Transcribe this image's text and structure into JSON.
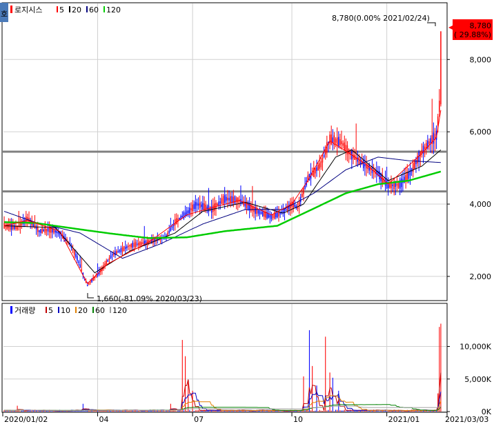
{
  "colors": {
    "up": "#ff0000",
    "down": "#0000ff",
    "ma5": "#ff0000",
    "ma20": "#000000",
    "ma60": "#000080",
    "ma120": "#00cc00",
    "vol5": "#c00000",
    "vol10": "#0000c0",
    "vol20": "#e08000",
    "vol60": "#008000",
    "vol120": "#a0a0a0",
    "support": "#808080",
    "grid": "#d0d0d0"
  },
  "legend_price": {
    "name": "로지시스",
    "items": [
      {
        "label": "5",
        "color": "#ff0000"
      },
      {
        "label": "20",
        "color": "#000000"
      },
      {
        "label": "60",
        "color": "#000080"
      },
      {
        "label": "120",
        "color": "#00cc00"
      }
    ]
  },
  "legend_volume": {
    "name": "거래량",
    "items": [
      {
        "label": "5",
        "color": "#c00000"
      },
      {
        "label": "10",
        "color": "#0000c0"
      },
      {
        "label": "20",
        "color": "#e08000"
      },
      {
        "label": "60",
        "color": "#008000"
      },
      {
        "label": "120",
        "color": "#a0a0a0"
      }
    ]
  },
  "corner_badge": "호",
  "annotations": {
    "high": "8,780(0.00% 2021/02/24)",
    "low": "1,660(-81.09% 2020/03/23)"
  },
  "current_price_box": {
    "price": "8,780",
    "change": "( 29.88%)"
  },
  "chart_data": [
    {
      "type": "candlestick",
      "panel": "price",
      "x_start": "2020/01/02",
      "x_end": "2021/03/03",
      "ylim": [
        1350,
        9550
      ],
      "yticks": [
        "2,000",
        "4,000",
        "6,000",
        "8,000"
      ],
      "ytick_values": [
        2000,
        4000,
        6000,
        8000
      ],
      "xticks": [
        "2020/01/02",
        "04",
        "07",
        "10",
        "2021/01",
        "2021/03/03"
      ],
      "support_lines": [
        5450,
        4350
      ],
      "anchors": [
        [
          "2020-01-02",
          3400
        ],
        [
          "2020-01-15",
          3350
        ],
        [
          "2020-01-25",
          3600
        ],
        [
          "2020-02-05",
          3250
        ],
        [
          "2020-02-15",
          3300
        ],
        [
          "2020-02-25",
          3200
        ],
        [
          "2020-03-05",
          2900
        ],
        [
          "2020-03-12",
          2500
        ],
        [
          "2020-03-23",
          1750
        ],
        [
          "2020-04-03",
          2150
        ],
        [
          "2020-04-15",
          2600
        ],
        [
          "2020-05-01",
          2850
        ],
        [
          "2020-05-20",
          2950
        ],
        [
          "2020-06-05",
          3100
        ],
        [
          "2020-06-15",
          3500
        ],
        [
          "2020-06-25",
          3750
        ],
        [
          "2020-07-05",
          4000
        ],
        [
          "2020-07-20",
          3850
        ],
        [
          "2020-08-01",
          4150
        ],
        [
          "2020-08-15",
          4100
        ],
        [
          "2020-09-01",
          3800
        ],
        [
          "2020-09-15",
          3650
        ],
        [
          "2020-09-28",
          3800
        ],
        [
          "2020-10-05",
          4000
        ],
        [
          "2020-10-10",
          3900
        ],
        [
          "2020-10-20",
          4700
        ],
        [
          "2020-11-01",
          5100
        ],
        [
          "2020-11-10",
          5800
        ],
        [
          "2020-11-20",
          5700
        ],
        [
          "2020-12-01",
          5350
        ],
        [
          "2020-12-15",
          5050
        ],
        [
          "2020-12-25",
          4850
        ],
        [
          "2021-01-05",
          4500
        ],
        [
          "2021-01-15",
          4550
        ],
        [
          "2021-01-25",
          4800
        ],
        [
          "2021-02-05",
          5450
        ],
        [
          "2021-02-15",
          5750
        ],
        [
          "2021-02-20",
          5900
        ],
        [
          "2021-02-23",
          6700
        ],
        [
          "2021-02-24",
          8780
        ]
      ],
      "ma_anchors": {
        "ma20": [
          [
            "2020-01-02",
            3400
          ],
          [
            "2020-02-20",
            3350
          ],
          [
            "2020-03-30",
            2100
          ],
          [
            "2020-05-01",
            2700
          ],
          [
            "2020-06-15",
            3200
          ],
          [
            "2020-07-10",
            3800
          ],
          [
            "2020-08-20",
            4050
          ],
          [
            "2020-09-25",
            3750
          ],
          [
            "2020-10-15",
            4000
          ],
          [
            "2020-11-15",
            5300
          ],
          [
            "2020-12-01",
            5500
          ],
          [
            "2021-01-05",
            4650
          ],
          [
            "2021-02-05",
            5050
          ],
          [
            "2021-02-24",
            5500
          ]
        ],
        "ma60": [
          [
            "2020-01-02",
            3800
          ],
          [
            "2020-02-01",
            3500
          ],
          [
            "2020-03-15",
            3200
          ],
          [
            "2020-04-25",
            2500
          ],
          [
            "2020-06-01",
            2900
          ],
          [
            "2020-07-10",
            3450
          ],
          [
            "2020-08-20",
            3850
          ],
          [
            "2020-09-25",
            3850
          ],
          [
            "2020-10-25",
            4300
          ],
          [
            "2020-11-25",
            4950
          ],
          [
            "2020-12-25",
            5300
          ],
          [
            "2021-01-25",
            5200
          ],
          [
            "2021-02-24",
            5150
          ]
        ],
        "ma120": [
          [
            "2020-01-02",
            3500
          ],
          [
            "2020-02-01",
            3480
          ],
          [
            "2020-03-15",
            3300
          ],
          [
            "2020-04-15",
            3180
          ],
          [
            "2020-05-20",
            3060
          ],
          [
            "2020-06-25",
            3080
          ],
          [
            "2020-08-01",
            3250
          ],
          [
            "2020-09-20",
            3400
          ],
          [
            "2020-10-20",
            3800
          ],
          [
            "2020-11-25",
            4300
          ],
          [
            "2020-12-25",
            4550
          ],
          [
            "2021-01-25",
            4650
          ],
          [
            "2021-02-24",
            4900
          ]
        ],
        "ma5": [
          [
            "2020-01-02",
            3400
          ],
          [
            "2020-01-25",
            3550
          ],
          [
            "2020-02-25",
            3250
          ],
          [
            "2020-03-23",
            1800
          ],
          [
            "2020-04-10",
            2350
          ],
          [
            "2020-05-20",
            2950
          ],
          [
            "2020-06-25",
            3700
          ],
          [
            "2020-07-20",
            3900
          ],
          [
            "2020-08-15",
            4100
          ],
          [
            "2020-09-15",
            3700
          ],
          [
            "2020-10-05",
            4000
          ],
          [
            "2020-10-20",
            4650
          ],
          [
            "2020-11-10",
            5750
          ],
          [
            "2020-12-15",
            5100
          ],
          [
            "2021-01-05",
            4550
          ],
          [
            "2021-02-05",
            5400
          ],
          [
            "2021-02-20",
            5850
          ],
          [
            "2021-02-24",
            6600
          ]
        ]
      }
    },
    {
      "type": "bar",
      "panel": "volume",
      "ylim": [
        0,
        14500
      ],
      "yticks": [
        "0K",
        "5,000K",
        "10,000K"
      ],
      "ytick_values": [
        0,
        5000,
        10000
      ],
      "spikes": [
        [
          "2020-01-15",
          900
        ],
        [
          "2020-03-18",
          1200
        ],
        [
          "2020-06-10",
          1200
        ],
        [
          "2020-06-22",
          11000
        ],
        [
          "2020-06-24",
          8500
        ],
        [
          "2020-06-26",
          4800
        ],
        [
          "2020-07-01",
          3200
        ],
        [
          "2020-10-15",
          5400
        ],
        [
          "2020-10-21",
          12500
        ],
        [
          "2020-10-23",
          7000
        ],
        [
          "2020-10-28",
          4000
        ],
        [
          "2020-11-05",
          11500
        ],
        [
          "2020-11-10",
          6000
        ],
        [
          "2020-11-12",
          5200
        ],
        [
          "2020-11-18",
          3200
        ],
        [
          "2021-02-22",
          2800
        ],
        [
          "2021-02-23",
          13000
        ],
        [
          "2021-02-24",
          13500
        ]
      ]
    }
  ]
}
